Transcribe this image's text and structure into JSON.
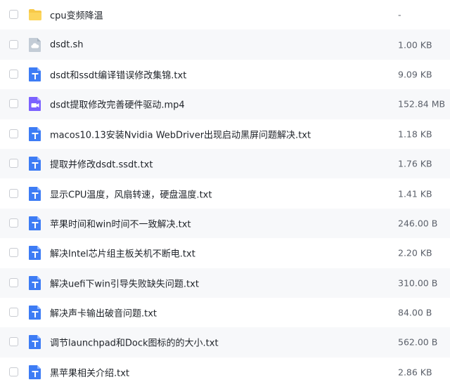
{
  "files": [
    {
      "name": "cpu变频降温",
      "size": "-",
      "icon": "folder-icon"
    },
    {
      "name": "dsdt.sh",
      "size": "1.00 KB",
      "icon": "cloud-file-icon"
    },
    {
      "name": "dsdt和ssdt编译错误修改集锦.txt",
      "size": "9.09 KB",
      "icon": "text-file-icon"
    },
    {
      "name": "dsdt提取修改完善硬件驱动.mp4",
      "size": "152.84 MB",
      "icon": "video-file-icon"
    },
    {
      "name": "macos10.13安装Nvidia WebDriver出现启动黑屏问题解决.txt",
      "size": "1.18 KB",
      "icon": "text-file-icon"
    },
    {
      "name": "提取并修改dsdt.ssdt.txt",
      "size": "1.76 KB",
      "icon": "text-file-icon"
    },
    {
      "name": "显示CPU温度，风扇转速，硬盘温度.txt",
      "size": "1.41 KB",
      "icon": "text-file-icon"
    },
    {
      "name": "苹果时间和win时间不一致解决.txt",
      "size": "246.00 B",
      "icon": "text-file-icon"
    },
    {
      "name": "解决Intel芯片组主板关机不断电.txt",
      "size": "2.20 KB",
      "icon": "text-file-icon"
    },
    {
      "name": "解决uefi下win引导失败缺失问题.txt",
      "size": "310.00 B",
      "icon": "text-file-icon"
    },
    {
      "name": "解决声卡输出破音问题.txt",
      "size": "84.00 B",
      "icon": "text-file-icon"
    },
    {
      "name": "调节launchpad和Dock图标的的大小.txt",
      "size": "562.00 B",
      "icon": "text-file-icon"
    },
    {
      "name": "黑苹果相关介绍.txt",
      "size": "2.86 KB",
      "icon": "text-file-icon"
    }
  ],
  "colors": {
    "folder": "#f7c948",
    "text_file": "#3d7cf5",
    "video_file": "#7b61ff",
    "cloud_file": "#b8c2cc",
    "alt_row": "#f7f8fa"
  }
}
